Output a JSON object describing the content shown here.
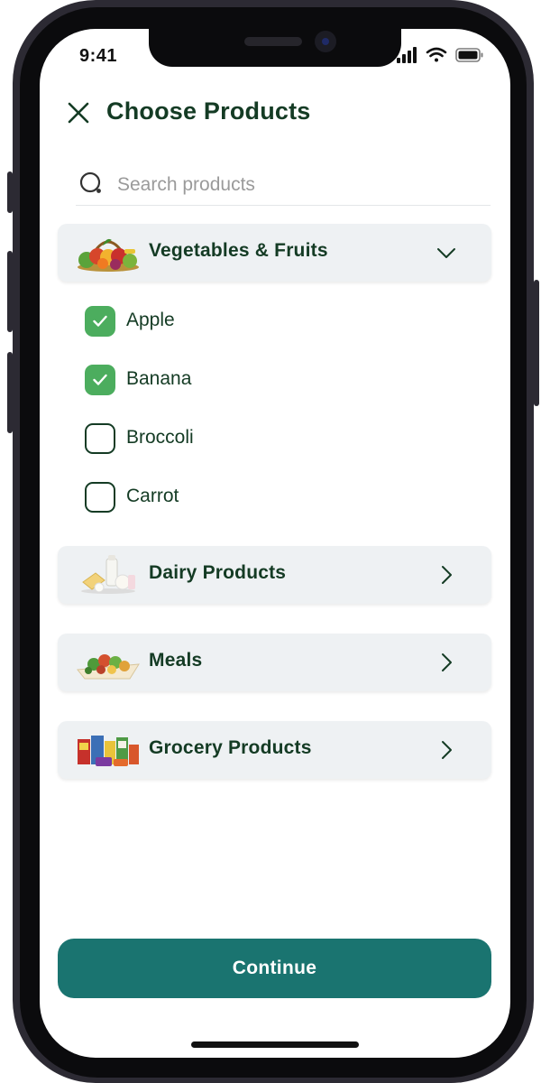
{
  "status_bar": {
    "time": "9:41"
  },
  "header": {
    "title": "Choose Products"
  },
  "search": {
    "placeholder": "Search products"
  },
  "categories": [
    {
      "label": "Vegetables & Fruits",
      "expanded": true,
      "items": [
        {
          "label": "Apple",
          "checked": true
        },
        {
          "label": "Banana",
          "checked": true
        },
        {
          "label": "Broccoli",
          "checked": false
        },
        {
          "label": "Carrot",
          "checked": false
        }
      ]
    },
    {
      "label": "Dairy Products",
      "expanded": false
    },
    {
      "label": "Meals",
      "expanded": false
    },
    {
      "label": "Grocery Products",
      "expanded": false
    }
  ],
  "footer": {
    "continue_label": "Continue"
  },
  "colors": {
    "title": "#143b24",
    "checked": "#4cad5e",
    "card_bg": "#eef1f3",
    "button": "#1a7470"
  },
  "icons": {
    "close": "close-icon",
    "search": "search-icon",
    "expanded": "chevron-down-icon",
    "collapsed": "chevron-right-icon",
    "checkmark": "checkmark-icon"
  }
}
